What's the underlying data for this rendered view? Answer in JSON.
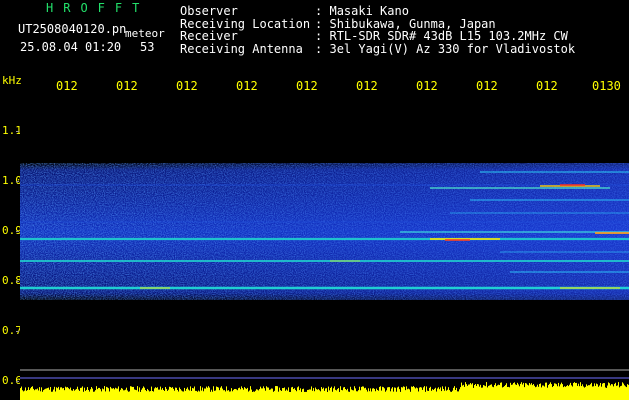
{
  "header": {
    "logo": "HROFFT",
    "filename": "UT2508040120.pn",
    "file_kind": "meteor",
    "date_time": "25.08.04 01:20",
    "count": "53"
  },
  "station": [
    {
      "key": "Observer",
      "sep": ":",
      "value": "Masaki Kano"
    },
    {
      "key": "Receiving Location",
      "sep": ":",
      "value": "Shibukawa, Gunma, Japan"
    },
    {
      "key": "Receiver",
      "sep": ":",
      "value": "RTL-SDR SDR# 43dB L15 103.2MHz CW"
    },
    {
      "key": "Receiving Antenna",
      "sep": ":",
      "value": "3el Yagi(V) Az 330 for Vladivostok"
    }
  ],
  "axis": {
    "unit_label": "kHz",
    "y_ticks": [
      "1.1",
      "1.0",
      "0.9",
      "0.8",
      "0.7",
      "0.6"
    ],
    "x_ticks": [
      "012",
      "012",
      "012",
      "012",
      "012",
      "012",
      "012",
      "012",
      "012",
      "0130"
    ]
  },
  "colors": {
    "background": "#000000",
    "label_yellow": "#ffff00",
    "logo_green": "#22e06a",
    "noise_blue": "#1030d0",
    "echo_cyan": "#20e0e0",
    "echo_red": "#ff4020",
    "level_yellow": "#ffff00"
  }
}
